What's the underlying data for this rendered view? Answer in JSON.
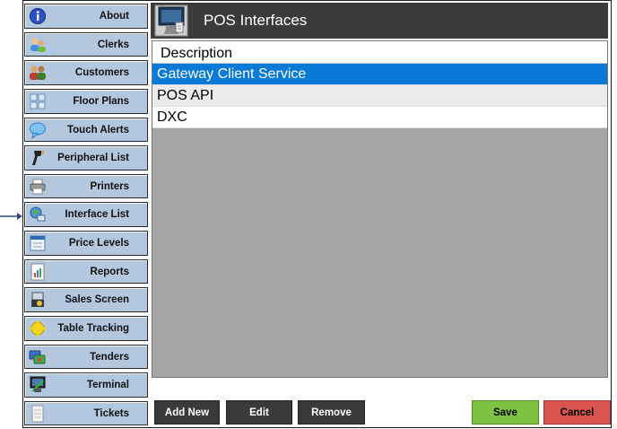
{
  "window": {
    "title": "POS Interfaces"
  },
  "sidebar": {
    "items": [
      {
        "label": "About",
        "icon": "info-icon"
      },
      {
        "label": "Clerks",
        "icon": "clerks-icon"
      },
      {
        "label": "Customers",
        "icon": "customers-icon"
      },
      {
        "label": "Floor Plans",
        "icon": "floor-plans-icon"
      },
      {
        "label": "Touch Alerts",
        "icon": "speech-bubble-icon"
      },
      {
        "label": "Peripheral List",
        "icon": "scanner-icon"
      },
      {
        "label": "Printers",
        "icon": "printer-icon"
      },
      {
        "label": "Interface List",
        "icon": "interface-icon"
      },
      {
        "label": "Price Levels",
        "icon": "price-levels-icon"
      },
      {
        "label": "Reports",
        "icon": "reports-icon"
      },
      {
        "label": "Sales Screen",
        "icon": "sales-screen-icon"
      },
      {
        "label": "Table Tracking",
        "icon": "table-tracking-icon"
      },
      {
        "label": "Tenders",
        "icon": "tenders-icon"
      },
      {
        "label": "Terminal",
        "icon": "terminal-icon"
      },
      {
        "label": "Tickets",
        "icon": "tickets-icon"
      }
    ]
  },
  "list": {
    "header": "Description",
    "rows": [
      "Gateway Client Service",
      "POS API",
      "DXC"
    ],
    "selected_index": 0
  },
  "buttons": {
    "add_new": "Add New",
    "edit": "Edit",
    "remove": "Remove",
    "save": "Save",
    "cancel": "Cancel"
  },
  "colors": {
    "header_bg": "#3b3b3b",
    "sidebar_button": "#b3c7df",
    "selection": "#0a7ad7",
    "save": "#7dc242",
    "cancel": "#d9534f"
  }
}
